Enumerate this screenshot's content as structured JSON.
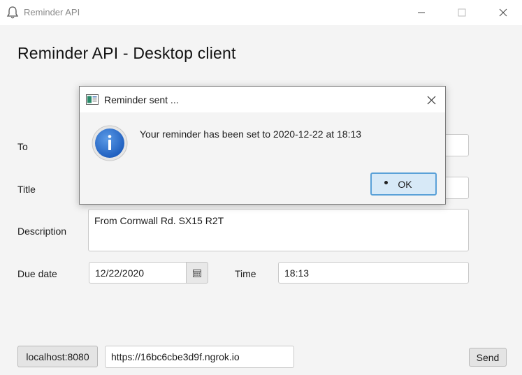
{
  "window": {
    "title": "Reminder API",
    "icon": "bell-icon"
  },
  "page": {
    "title": "Reminder API - Desktop client"
  },
  "form": {
    "to_label": "To",
    "to_value": "",
    "title_label": "Title",
    "title_value": "",
    "description_label": "Description",
    "description_value": "From Cornwall Rd. SX15 R2T",
    "due_date_label": "Due date",
    "due_date_value": "12/22/2020",
    "calendar_icon": "calendar-icon",
    "time_label": "Time",
    "time_value": "18:13"
  },
  "footer": {
    "server_button": "localhost:8080",
    "url_value": "https://16bc6cbe3d9f.ngrok.io",
    "send_button": "Send"
  },
  "dialog": {
    "title": "Reminder sent ...",
    "message": "Your reminder has been set to 2020-12-22 at 18:13",
    "ok_button": "OK",
    "icon": "info-icon"
  },
  "colors": {
    "window_bg": "#f4f4f4",
    "dialog_accent": "#5aa1d8",
    "info_blue": "#2a6ec8"
  }
}
